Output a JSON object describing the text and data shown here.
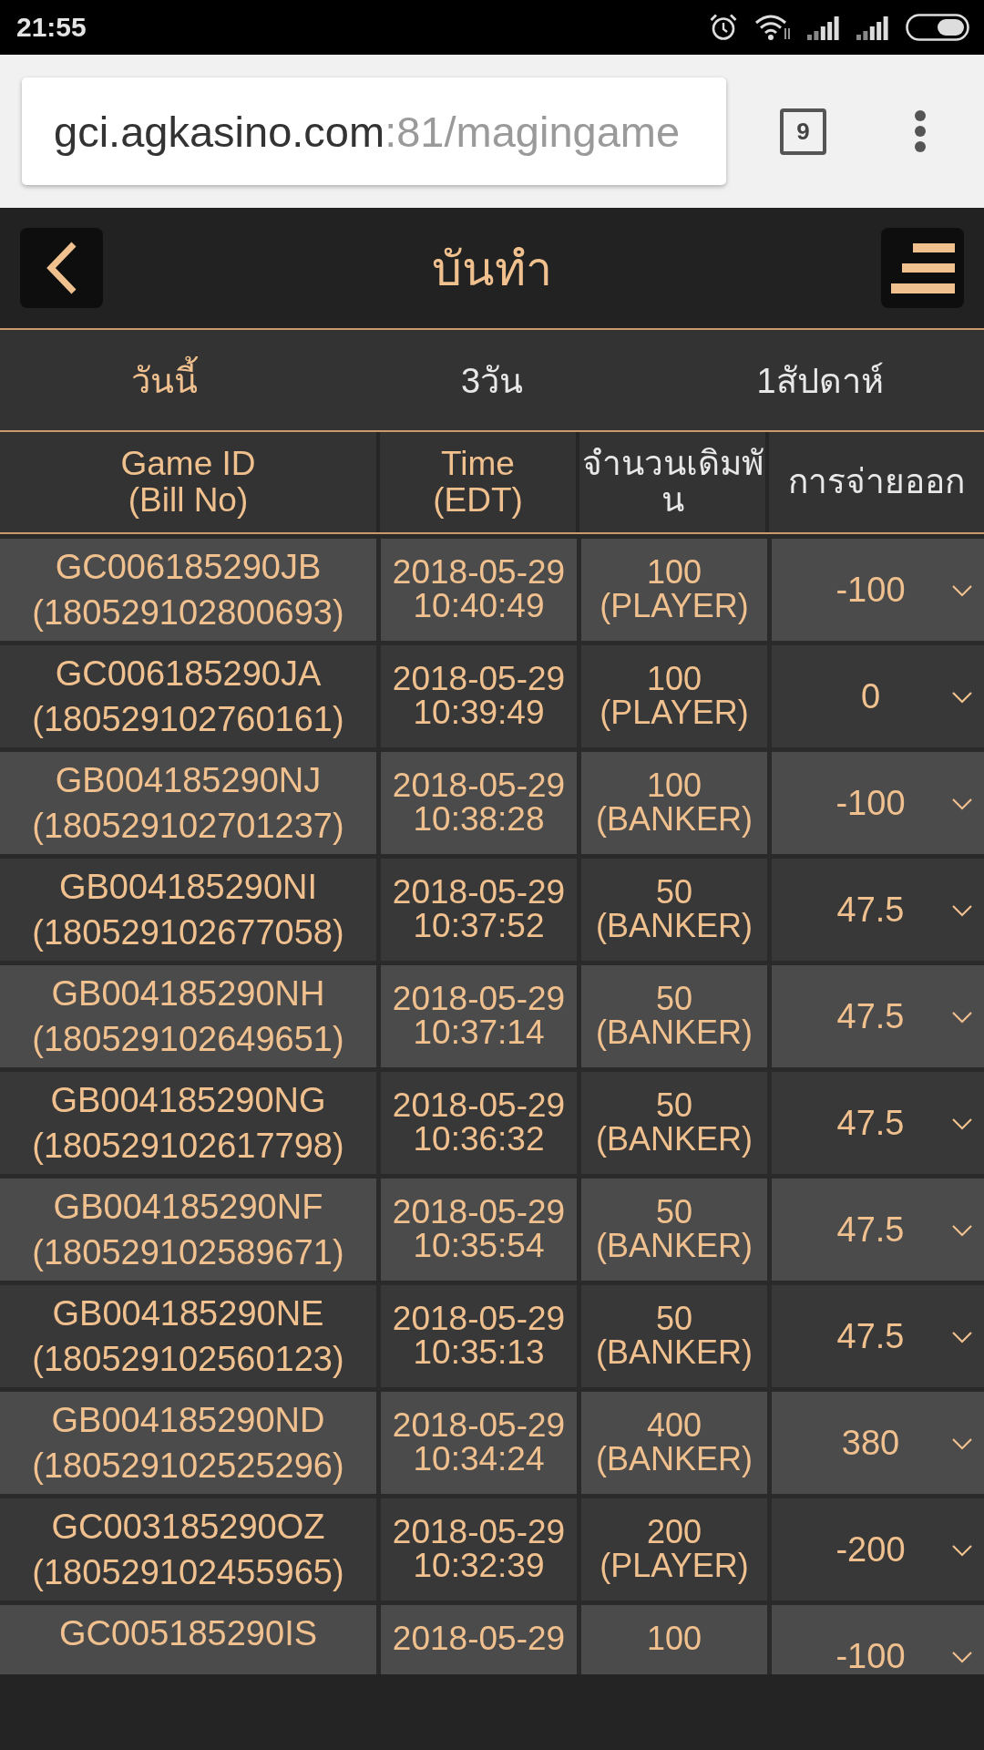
{
  "status_bar": {
    "time": "21:55"
  },
  "browser": {
    "url_host": "gci.agkasino.com",
    "url_path": ":81/magingame",
    "tab_count": "9"
  },
  "header": {
    "title": "บันทำ"
  },
  "tabs": [
    {
      "label": "วันนี้",
      "selected": true
    },
    {
      "label": "3วัน",
      "selected": false
    },
    {
      "label": "1สัปดาห์",
      "selected": false
    }
  ],
  "table": {
    "columns": [
      {
        "title": "Game ID",
        "subtitle": "(Bill No)",
        "color": "#f0c08e"
      },
      {
        "title": "Time",
        "subtitle": "(EDT)",
        "color": "#f0c08e"
      },
      {
        "title": "จำนวนเดิมพัน",
        "color": "#e8e8e8"
      },
      {
        "title": "การจ่ายออก",
        "color": "#e8e8e8"
      }
    ],
    "rows": [
      {
        "game_id": "GC006185290JB",
        "bill_no": "(180529102800693)",
        "date": "2018-05-29",
        "time": "10:40:49",
        "bet": "100",
        "side": "(PLAYER)",
        "payout": "-100"
      },
      {
        "game_id": "GC006185290JA",
        "bill_no": "(180529102760161)",
        "date": "2018-05-29",
        "time": "10:39:49",
        "bet": "100",
        "side": "(PLAYER)",
        "payout": "0"
      },
      {
        "game_id": "GB004185290NJ",
        "bill_no": "(180529102701237)",
        "date": "2018-05-29",
        "time": "10:38:28",
        "bet": "100",
        "side": "(BANKER)",
        "payout": "-100"
      },
      {
        "game_id": "GB004185290NI",
        "bill_no": "(180529102677058)",
        "date": "2018-05-29",
        "time": "10:37:52",
        "bet": "50",
        "side": "(BANKER)",
        "payout": "47.5"
      },
      {
        "game_id": "GB004185290NH",
        "bill_no": "(180529102649651)",
        "date": "2018-05-29",
        "time": "10:37:14",
        "bet": "50",
        "side": "(BANKER)",
        "payout": "47.5"
      },
      {
        "game_id": "GB004185290NG",
        "bill_no": "(180529102617798)",
        "date": "2018-05-29",
        "time": "10:36:32",
        "bet": "50",
        "side": "(BANKER)",
        "payout": "47.5"
      },
      {
        "game_id": "GB004185290NF",
        "bill_no": "(180529102589671)",
        "date": "2018-05-29",
        "time": "10:35:54",
        "bet": "50",
        "side": "(BANKER)",
        "payout": "47.5"
      },
      {
        "game_id": "GB004185290NE",
        "bill_no": "(180529102560123)",
        "date": "2018-05-29",
        "time": "10:35:13",
        "bet": "50",
        "side": "(BANKER)",
        "payout": "47.5"
      },
      {
        "game_id": "GB004185290ND",
        "bill_no": "(180529102525296)",
        "date": "2018-05-29",
        "time": "10:34:24",
        "bet": "400",
        "side": "(BANKER)",
        "payout": "380"
      },
      {
        "game_id": "GC003185290OZ",
        "bill_no": "(180529102455965)",
        "date": "2018-05-29",
        "time": "10:32:39",
        "bet": "200",
        "side": "(PLAYER)",
        "payout": "-200"
      },
      {
        "game_id": "GC005185290IS",
        "date": "2018-05-29",
        "bet": "100",
        "payout": "-100"
      }
    ]
  }
}
